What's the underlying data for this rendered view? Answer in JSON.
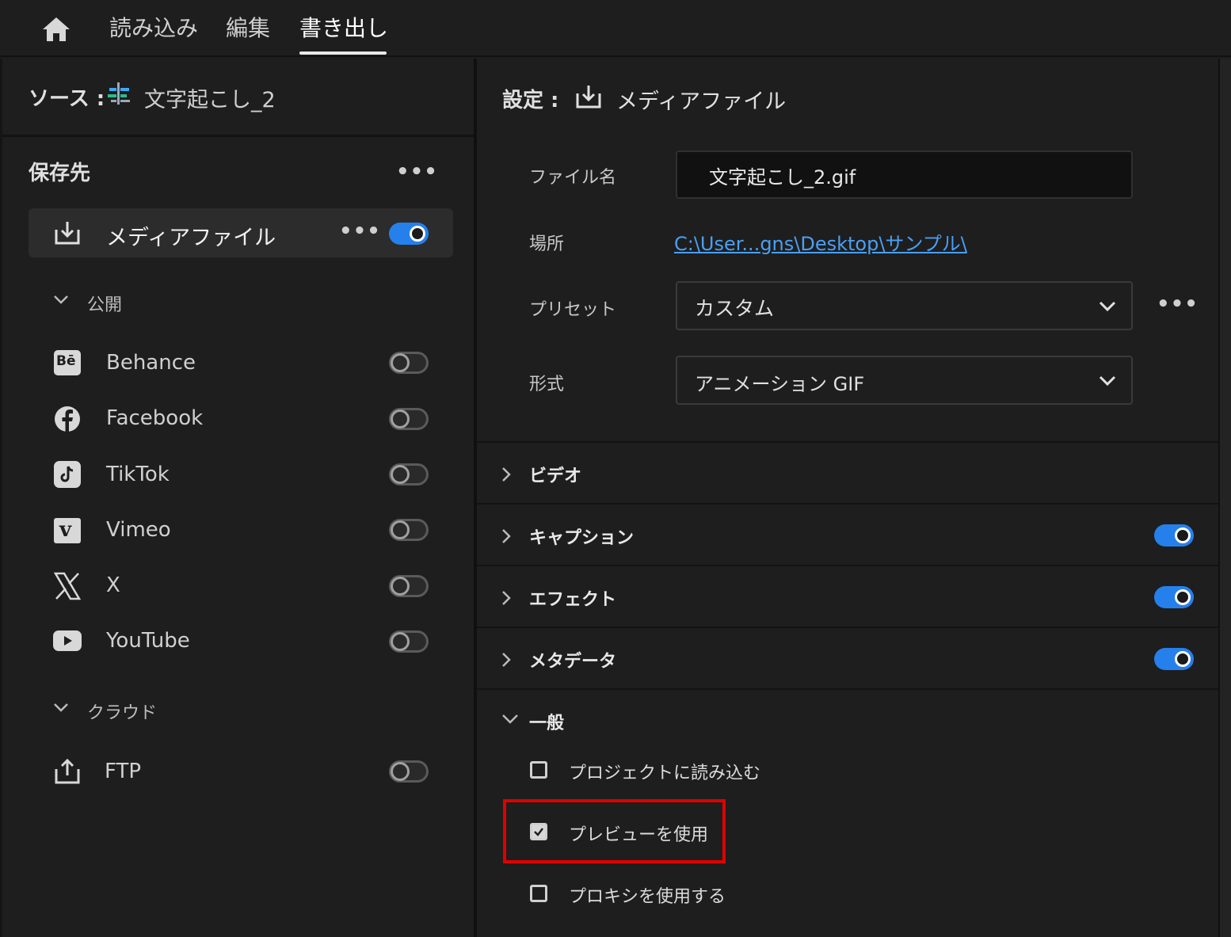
{
  "nav": {
    "tabs": [
      "読み込み",
      "編集",
      "書き出し"
    ]
  },
  "source": {
    "label": "ソース :",
    "name": "文字起こし_2"
  },
  "destinations": {
    "title": "保存先",
    "media_file": {
      "label": "メディアファイル",
      "enabled": true
    },
    "publish": {
      "label": "公開",
      "items": [
        {
          "label": "Behance",
          "icon": "behance-icon",
          "enabled": false
        },
        {
          "label": "Facebook",
          "icon": "facebook-icon",
          "enabled": false
        },
        {
          "label": "TikTok",
          "icon": "tiktok-icon",
          "enabled": false
        },
        {
          "label": "Vimeo",
          "icon": "vimeo-icon",
          "enabled": false
        },
        {
          "label": "X",
          "icon": "x-icon",
          "enabled": false
        },
        {
          "label": "YouTube",
          "icon": "youtube-icon",
          "enabled": false
        }
      ]
    },
    "cloud": {
      "label": "クラウド",
      "items": [
        {
          "label": "FTP",
          "icon": "upload-icon",
          "enabled": false
        }
      ]
    }
  },
  "settings": {
    "label": "設定 :",
    "target": "メディアファイル",
    "file_name_label": "ファイル名",
    "file_name_value": "文字起こし_2.gif",
    "location_label": "場所",
    "location_value": "C:\\User...gns\\Desktop\\サンプル\\",
    "preset_label": "プリセット",
    "preset_value": "カスタム",
    "format_label": "形式",
    "format_value": "アニメーション GIF"
  },
  "sections": [
    {
      "label": "ビデオ",
      "expanded": false,
      "toggle": null
    },
    {
      "label": "キャプション",
      "expanded": false,
      "toggle": true
    },
    {
      "label": "エフェクト",
      "expanded": false,
      "toggle": true
    },
    {
      "label": "メタデータ",
      "expanded": false,
      "toggle": true
    }
  ],
  "general": {
    "label": "一般",
    "expanded": true,
    "options": [
      {
        "label": "プロジェクトに読み込む",
        "checked": false
      },
      {
        "label": "プレビューを使用",
        "checked": true,
        "highlighted": true
      },
      {
        "label": "プロキシを使用する",
        "checked": false
      }
    ]
  },
  "colors": {
    "accent": "#2680eb",
    "highlight": "#e00000",
    "link": "#4a9ff5"
  }
}
